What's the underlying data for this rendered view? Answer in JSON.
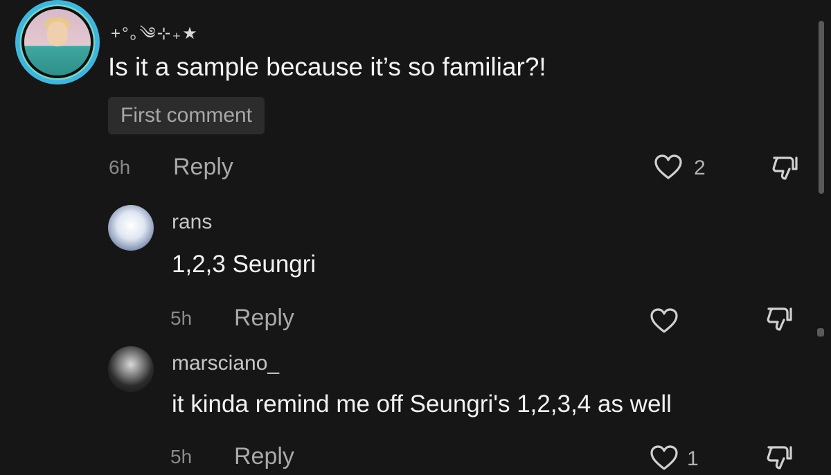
{
  "main_comment": {
    "decoration": "+°｡༄⊹₊★",
    "text": "Is it a sample because it’s so familiar?!",
    "badge": "First comment",
    "time": "6h",
    "reply_label": "Reply",
    "like_count": "2"
  },
  "replies": [
    {
      "username": "rans",
      "text": "1,2,3 Seungri",
      "time": "5h",
      "reply_label": "Reply",
      "like_count": ""
    },
    {
      "username": "marsciano_",
      "text": "it kinda remind me off Seungri's 1,2,3,4 as well",
      "time": "5h",
      "reply_label": "Reply",
      "like_count": "1"
    }
  ],
  "icons": {
    "like": "heart-icon",
    "dislike": "thumbs-down-icon"
  },
  "colors": {
    "background": "#161616",
    "avatar_ring": "#3fb6e0",
    "badge_bg": "#2c2c2c"
  }
}
